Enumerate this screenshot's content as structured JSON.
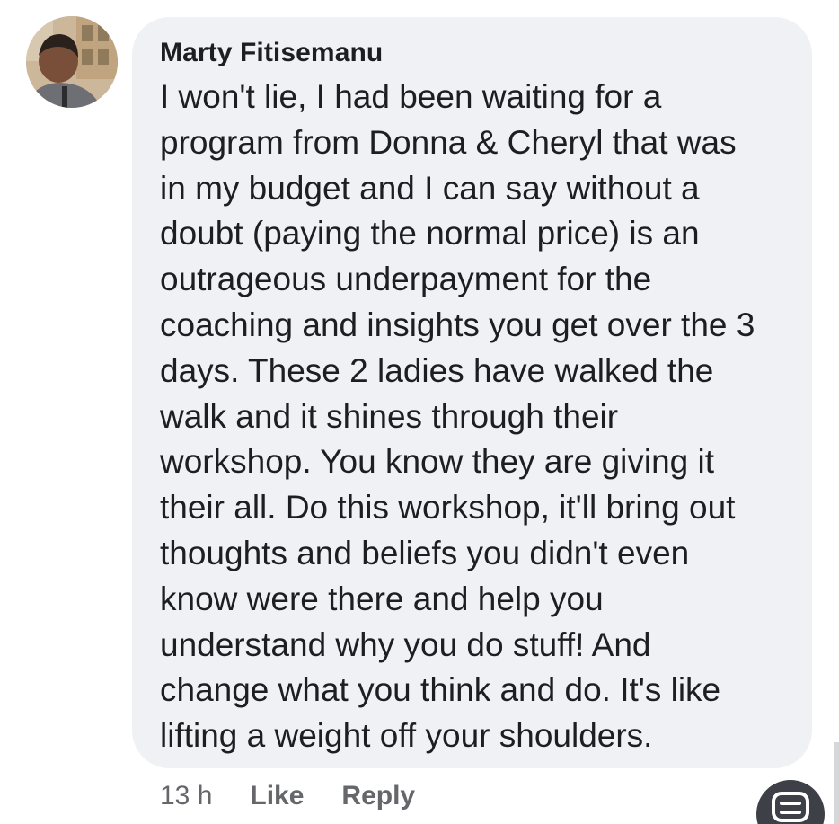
{
  "comment": {
    "author": "Marty Fitisemanu",
    "lines": [
      "I won't lie, I had been waiting for a",
      "program from Donna & Cheryl that was",
      "in my budget and I can say without a",
      "doubt (paying the normal price) is an",
      "outrageous underpayment for the",
      "coaching and insights you get over the 3",
      "days. These 2 ladies have walked the",
      "walk and it shines through their",
      "workshop. You know they are giving it",
      "their all. Do this workshop, it'll bring out",
      "thoughts and beliefs you didn't even",
      "know were there and help you",
      "understand why you do stuff! And",
      "change what you think and do. It's like",
      "lifting a weight off your shoulders."
    ],
    "timestamp": "13 h",
    "like_label": "Like",
    "reply_label": "Reply"
  },
  "icons": {
    "avatar": "user-profile-photo",
    "floating_button": "chat-bubble-icon"
  },
  "colors": {
    "bubble_background": "#eff1f4",
    "text": "#1c1e21",
    "secondary_text": "#65676b",
    "floating_button": "#3d4046"
  }
}
